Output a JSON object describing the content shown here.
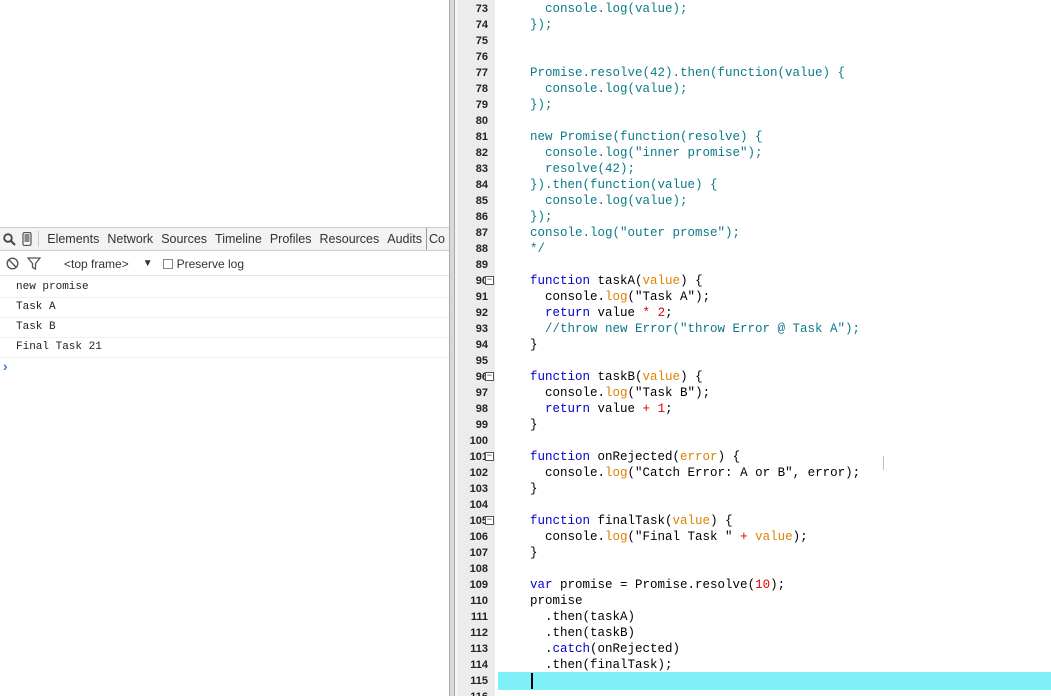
{
  "devtools": {
    "tabs": [
      "Elements",
      "Network",
      "Sources",
      "Timeline",
      "Profiles",
      "Resources",
      "Audits",
      "Co"
    ],
    "icons": [
      "search-icon",
      "device-mode-icon"
    ],
    "frame_selector": "<top frame>",
    "preserve_log_label": "Preserve log"
  },
  "console": {
    "messages": [
      "new promise",
      "Task A",
      "Task B",
      "Final Task 21"
    ],
    "prompt": "›"
  },
  "editor": {
    "lines": [
      {
        "n": "73",
        "code": "    console.log(value);",
        "style": "teal"
      },
      {
        "n": "74",
        "code": "  });",
        "style": "teal"
      },
      {
        "n": "75",
        "code": "",
        "style": "teal"
      },
      {
        "n": "76",
        "code": "",
        "style": "teal"
      },
      {
        "n": "77",
        "code": "  Promise.resolve(42).then(function(value) {",
        "style": "teal"
      },
      {
        "n": "78",
        "code": "    console.log(value);",
        "style": "teal"
      },
      {
        "n": "79",
        "code": "  });",
        "style": "teal"
      },
      {
        "n": "80",
        "code": "",
        "style": "teal"
      },
      {
        "n": "81",
        "code": "  new Promise(function(resolve) {",
        "style": "teal"
      },
      {
        "n": "82",
        "code": "    console.log(\"inner promise\");",
        "style": "teal"
      },
      {
        "n": "83",
        "code": "    resolve(42);",
        "style": "teal"
      },
      {
        "n": "84",
        "code": "  }).then(function(value) {",
        "style": "teal"
      },
      {
        "n": "85",
        "code": "    console.log(value);",
        "style": "teal"
      },
      {
        "n": "86",
        "code": "  });",
        "style": "teal"
      },
      {
        "n": "87",
        "code": "  console.log(\"outer promse\");",
        "style": "teal"
      },
      {
        "n": "88",
        "code": "  */",
        "style": "teal"
      },
      {
        "n": "89",
        "code": "",
        "style": "plain"
      },
      {
        "n": "90",
        "code": "  function taskA(value) {",
        "style": "fn",
        "fold": true
      },
      {
        "n": "91",
        "code": "    console.log(\"Task A\");",
        "style": "log"
      },
      {
        "n": "92",
        "code": "    return value * 2;",
        "style": "ret"
      },
      {
        "n": "93",
        "code": "    //throw new Error(\"throw Error @ Task A\");",
        "style": "teal"
      },
      {
        "n": "94",
        "code": "  }",
        "style": "plain"
      },
      {
        "n": "95",
        "code": "",
        "style": "plain"
      },
      {
        "n": "96",
        "code": "  function taskB(value) {",
        "style": "fn",
        "fold": true
      },
      {
        "n": "97",
        "code": "    console.log(\"Task B\");",
        "style": "log"
      },
      {
        "n": "98",
        "code": "    return value + 1;",
        "style": "ret"
      },
      {
        "n": "99",
        "code": "  }",
        "style": "plain"
      },
      {
        "n": "100",
        "code": "",
        "style": "plain"
      },
      {
        "n": "101",
        "code": "  function onRejected(error) {",
        "style": "fn",
        "fold": true
      },
      {
        "n": "102",
        "code": "    console.log(\"Catch Error: A or B\", error);",
        "style": "log"
      },
      {
        "n": "103",
        "code": "  }",
        "style": "plain"
      },
      {
        "n": "104",
        "code": "",
        "style": "plain"
      },
      {
        "n": "105",
        "code": "  function finalTask(value) {",
        "style": "fn",
        "fold": true
      },
      {
        "n": "106",
        "code": "    console.log(\"Final Task \" + value);",
        "style": "log"
      },
      {
        "n": "107",
        "code": "  }",
        "style": "plain"
      },
      {
        "n": "108",
        "code": "",
        "style": "plain"
      },
      {
        "n": "109",
        "code": "  var promise = Promise.resolve(10);",
        "style": "var"
      },
      {
        "n": "110",
        "code": "  promise",
        "style": "plain"
      },
      {
        "n": "111",
        "code": "    .then(taskA)",
        "style": "chain"
      },
      {
        "n": "112",
        "code": "    .then(taskB)",
        "style": "chain"
      },
      {
        "n": "113",
        "code": "    .catch(onRejected)",
        "style": "chain"
      },
      {
        "n": "114",
        "code": "    .then(finalTask);",
        "style": "chain"
      },
      {
        "n": "115",
        "code": "",
        "style": "plain"
      },
      {
        "n": "116",
        "code": "",
        "style": "plain"
      }
    ]
  },
  "colors": {
    "current_line": "#80f0f8",
    "comment_teal": "#0b7a8a",
    "keyword": "#0000cc",
    "variable": "#e08000",
    "number": "#e00000"
  }
}
